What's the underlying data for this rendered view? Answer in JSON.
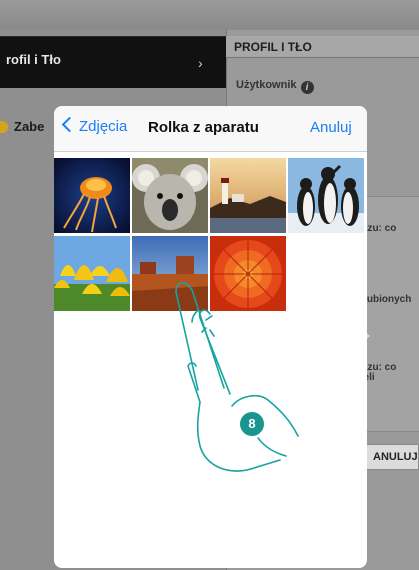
{
  "background_app": {
    "left_item": {
      "title": "rofil i Tło",
      "chevron": "›"
    },
    "left_item_2": {
      "label": "Zabe"
    },
    "right_panel": {
      "header": "PROFIL I TŁO",
      "user_label": "Użytkownik",
      "info_icon": "i",
      "snippet_1": "razu: co\nli",
      "snippet_2": "ulubionych",
      "snippet_3": "razu: co\nseli",
      "cancel_button": "ANULUJ"
    }
  },
  "picker": {
    "back_label": "Zdjęcia",
    "title": "Rolka z aparatu",
    "cancel_label": "Anuluj",
    "photos": [
      {
        "name": "jellyfish"
      },
      {
        "name": "koala"
      },
      {
        "name": "lighthouse"
      },
      {
        "name": "penguins"
      },
      {
        "name": "tulips"
      },
      {
        "name": "desert"
      },
      {
        "name": "chrysanthemum"
      }
    ]
  },
  "overlay": {
    "step_number": "8",
    "accent": "#17958e"
  },
  "colors": {
    "ios_blue": "#1a7ef5"
  }
}
